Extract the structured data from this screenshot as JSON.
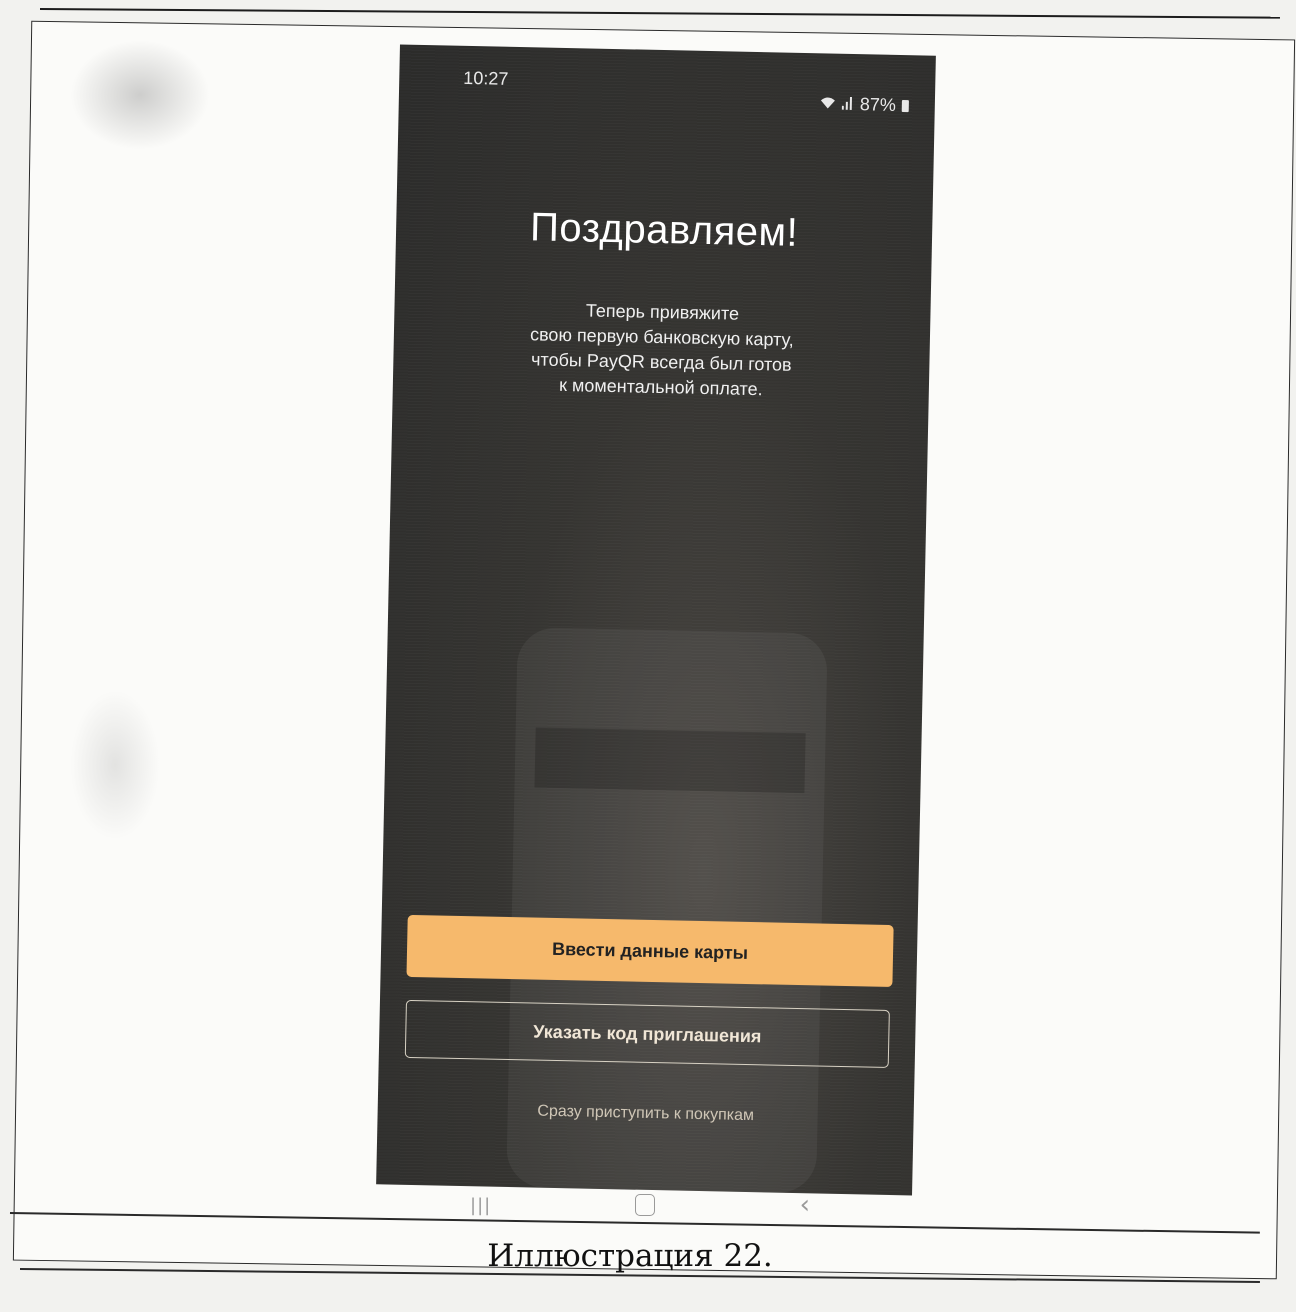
{
  "status_bar": {
    "time": "10:27",
    "battery": "87%",
    "icons": [
      "wifi-icon",
      "signal-icon",
      "battery-icon"
    ]
  },
  "screen": {
    "headline": "Поздравляем!",
    "subtext_lines": [
      "Теперь привяжите",
      "свою первую банковскую карту,",
      "чтобы PayQR всегда был готов",
      "к моментальной оплате."
    ],
    "primary_button": "Ввести данные карты",
    "secondary_button": "Указать код приглашения",
    "skip_link": "Сразу приступить к покупкам"
  },
  "nav_bar": {
    "recent": "|||",
    "back": "‹"
  },
  "caption": "Иллюстрация 22.",
  "colors": {
    "primary_button": "#f6b96c",
    "screen_background": "#353431"
  }
}
